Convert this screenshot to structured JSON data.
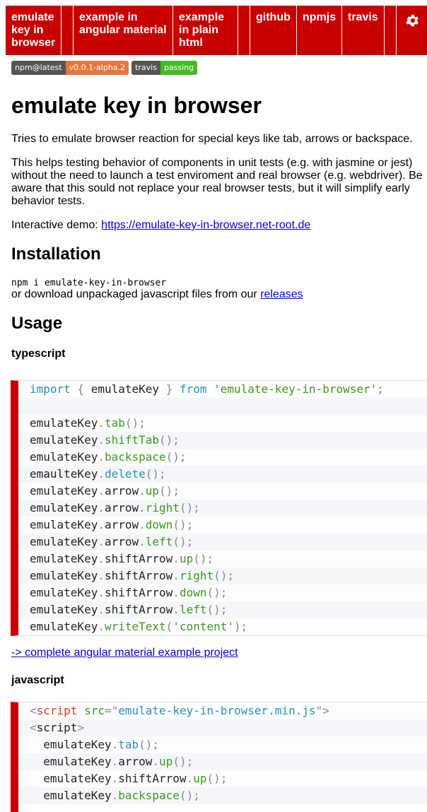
{
  "nav": {
    "items": [
      "emulate key in browser",
      "",
      "example in angular material",
      "example in plain html",
      "",
      "github",
      "npmjs",
      "travis",
      ""
    ],
    "settings_icon": "gear-icon"
  },
  "badges": [
    {
      "left": "npm@latest",
      "right": "v0.0.1-alpha.2",
      "color": "#e8763a"
    },
    {
      "left": "travis",
      "right": "passing",
      "color": "#44bb22"
    }
  ],
  "title": "emulate key in browser",
  "intro": "Tries to emulate browser reaction for special keys like tab, arrows or backspace.",
  "description": "This helps testing behavior of components in unit tests (e.g. with jasmine or jest) without the need to launch a test enviroment and real browser (e.g. webdriver). Be aware that this sould not replace your real browser tests, but it will simplify early behavior tests.",
  "demo": {
    "label": "Interactive demo: ",
    "link": "https://emulate-key-in-browser.net-root.de"
  },
  "installation": {
    "heading": "Installation",
    "command": "npm i emulate-key-in-browser",
    "text": "or download unpackaged javascript files from our ",
    "link": "releases"
  },
  "usage": {
    "heading": "Usage",
    "ts_heading": "typescript",
    "example_link": "-> complete angular material example project",
    "js_heading": "javascript"
  },
  "ts_code": [
    [
      [
        "import",
        "k"
      ],
      [
        " { ",
        "p"
      ],
      [
        "emulateKey",
        "n"
      ],
      [
        " } ",
        "p"
      ],
      [
        "from",
        "k"
      ],
      [
        " ",
        "n"
      ],
      [
        "'emulate-key-in-browser'",
        "s"
      ],
      [
        ";",
        "p"
      ]
    ],
    [],
    [
      [
        "emulateKey",
        "n"
      ],
      [
        ".",
        "p"
      ],
      [
        "tab",
        "m"
      ],
      [
        "();",
        "p"
      ]
    ],
    [
      [
        "emulateKey",
        "n"
      ],
      [
        ".",
        "p"
      ],
      [
        "shiftTab",
        "m"
      ],
      [
        "();",
        "p"
      ]
    ],
    [
      [
        "emulateKey",
        "n"
      ],
      [
        ".",
        "p"
      ],
      [
        "backspace",
        "m"
      ],
      [
        "();",
        "p"
      ]
    ],
    [
      [
        "emaulteKey",
        "n"
      ],
      [
        ".",
        "p"
      ],
      [
        "delete",
        "b"
      ],
      [
        "();",
        "p"
      ]
    ],
    [
      [
        "emulateKey",
        "n"
      ],
      [
        ".",
        "p"
      ],
      [
        "arrow",
        "n"
      ],
      [
        ".",
        "p"
      ],
      [
        "up",
        "m"
      ],
      [
        "();",
        "p"
      ]
    ],
    [
      [
        "emulateKey",
        "n"
      ],
      [
        ".",
        "p"
      ],
      [
        "arrow",
        "n"
      ],
      [
        ".",
        "p"
      ],
      [
        "right",
        "m"
      ],
      [
        "();",
        "p"
      ]
    ],
    [
      [
        "emulateKey",
        "n"
      ],
      [
        ".",
        "p"
      ],
      [
        "arrow",
        "n"
      ],
      [
        ".",
        "p"
      ],
      [
        "down",
        "m"
      ],
      [
        "();",
        "p"
      ]
    ],
    [
      [
        "emulateKey",
        "n"
      ],
      [
        ".",
        "p"
      ],
      [
        "arrow",
        "n"
      ],
      [
        ".",
        "p"
      ],
      [
        "left",
        "m"
      ],
      [
        "();",
        "p"
      ]
    ],
    [
      [
        "emulateKey",
        "n"
      ],
      [
        ".",
        "p"
      ],
      [
        "shiftArrow",
        "n"
      ],
      [
        ".",
        "p"
      ],
      [
        "up",
        "m"
      ],
      [
        "();",
        "p"
      ]
    ],
    [
      [
        "emulateKey",
        "n"
      ],
      [
        ".",
        "p"
      ],
      [
        "shiftArrow",
        "n"
      ],
      [
        ".",
        "p"
      ],
      [
        "right",
        "m"
      ],
      [
        "();",
        "p"
      ]
    ],
    [
      [
        "emulateKey",
        "n"
      ],
      [
        ".",
        "p"
      ],
      [
        "shiftArrow",
        "n"
      ],
      [
        ".",
        "p"
      ],
      [
        "down",
        "m"
      ],
      [
        "();",
        "p"
      ]
    ],
    [
      [
        "emulateKey",
        "n"
      ],
      [
        ".",
        "p"
      ],
      [
        "shiftArrow",
        "n"
      ],
      [
        ".",
        "p"
      ],
      [
        "left",
        "m"
      ],
      [
        "();",
        "p"
      ]
    ],
    [
      [
        "emulateKey",
        "n"
      ],
      [
        ".",
        "p"
      ],
      [
        "writeText",
        "m"
      ],
      [
        "(",
        "p"
      ],
      [
        "'content'",
        "s"
      ],
      [
        ");",
        "p"
      ]
    ]
  ],
  "js_code": [
    [
      [
        "<",
        "p"
      ],
      [
        "script",
        "t"
      ],
      [
        " ",
        "n"
      ],
      [
        "src",
        "m"
      ],
      [
        "=\"",
        "p"
      ],
      [
        "emulate-key-in-browser.min.js",
        "b"
      ],
      [
        "\">",
        "p"
      ]
    ],
    [
      [
        "<",
        "p"
      ],
      [
        "script",
        "n"
      ],
      [
        ">",
        "p"
      ]
    ],
    [
      [
        "  emulateKey",
        "n"
      ],
      [
        ".",
        "p"
      ],
      [
        "tab",
        "b"
      ],
      [
        "();",
        "p"
      ]
    ],
    [
      [
        "  emulateKey",
        "n"
      ],
      [
        ".",
        "p"
      ],
      [
        "arrow",
        "n"
      ],
      [
        ".",
        "p"
      ],
      [
        "up",
        "m"
      ],
      [
        "();",
        "p"
      ]
    ],
    [
      [
        "  emulateKey",
        "n"
      ],
      [
        ".",
        "p"
      ],
      [
        "shiftArrow",
        "n"
      ],
      [
        ".",
        "p"
      ],
      [
        "up",
        "m"
      ],
      [
        "();",
        "p"
      ]
    ],
    [
      [
        "  emulateKey",
        "n"
      ],
      [
        ".",
        "p"
      ],
      [
        "backspace",
        "m"
      ],
      [
        "();",
        "p"
      ]
    ]
  ]
}
